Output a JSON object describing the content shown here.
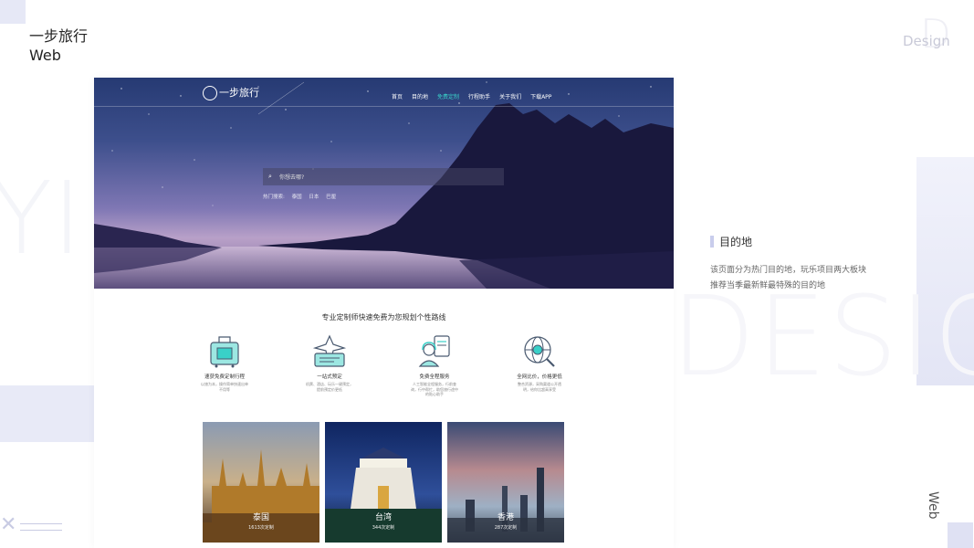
{
  "presentation": {
    "title": "一步旅行",
    "subtitle": "Web",
    "corner_design": "Design",
    "vertical_label": "Web",
    "section": {
      "title": "目的地",
      "desc_line1": "该页面分为热门目的地，玩乐项目两大板块",
      "desc_line2": "推荐当季最新鲜最特殊的目的地"
    }
  },
  "site": {
    "logo_text": "一步旅行",
    "nav": [
      {
        "label": "首页",
        "active": false
      },
      {
        "label": "目的地",
        "active": false
      },
      {
        "label": "免费定制",
        "active": true
      },
      {
        "label": "行程助手",
        "active": false
      },
      {
        "label": "关于我们",
        "active": false
      },
      {
        "label": "下载APP",
        "active": false
      }
    ],
    "search_placeholder": "你想去哪?",
    "hot": {
      "label": "热门搜索:",
      "items": [
        "泰国",
        "日本",
        "巴厘"
      ]
    },
    "intro_title": "专业定制师快速免费为您规划个性路线",
    "features": [
      {
        "title": "速获免费定制行程",
        "desc": "以旅为本，操作简单快速出单不用等",
        "icon": "luggage-icon"
      },
      {
        "title": "一站式预定",
        "desc": "机票、酒店、玩乐一键预定，提前预定价更低",
        "icon": "plane-ticket-icon"
      },
      {
        "title": "免费全程服务",
        "desc": "人工智能全程服务，行前查询，行中帮忙，助您旅行途中的贴心助手",
        "icon": "support-agent-icon"
      },
      {
        "title": "全网比价，价格更低",
        "desc": "整合资源，采购渠道公开透明，给你比超高享受",
        "icon": "globe-search-icon"
      }
    ],
    "destinations": [
      {
        "name": "泰国",
        "count": "1613次定制"
      },
      {
        "name": "台湾",
        "count": "344次定制"
      },
      {
        "name": "香港",
        "count": "287次定制"
      }
    ]
  },
  "colors": {
    "accent": "#39d0c8",
    "decor": "#e6e8f6",
    "hero_top": "#263a73",
    "hero_glow": "#b8a0c8"
  }
}
